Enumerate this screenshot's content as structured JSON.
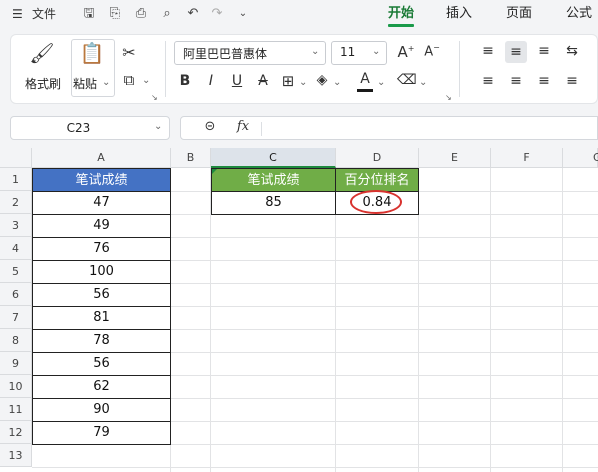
{
  "menubar": {
    "menu_icon": "☰",
    "file_label": "文件",
    "tabs": [
      "开始",
      "插入",
      "页面",
      "公式"
    ]
  },
  "ribbon": {
    "format_painter_label": "格式刷",
    "paste_label": "粘贴",
    "font_name": "阿里巴巴普惠体",
    "font_size": "11",
    "bold": "B",
    "italic": "I",
    "underline": "U",
    "strike": "A",
    "font_color_letter": "A",
    "font_color": "#1a1a1a",
    "grow_font": "A",
    "shrink_font": "A"
  },
  "formula_bar": {
    "name_box": "C23",
    "fx": "fx",
    "formula": ""
  },
  "sheet": {
    "columns": [
      "A",
      "B",
      "C",
      "D",
      "E",
      "F",
      "G"
    ],
    "rows": [
      "1",
      "2",
      "3",
      "4",
      "5",
      "6",
      "7",
      "8",
      "9",
      "10",
      "11",
      "12",
      "13"
    ],
    "a_header": "笔试成绩",
    "a_values": [
      "47",
      "49",
      "76",
      "100",
      "56",
      "81",
      "78",
      "56",
      "62",
      "90",
      "79"
    ],
    "c_header": "笔试成绩",
    "c_value": "85",
    "d_header": "百分位排名",
    "d_value": "0.84",
    "header_blue": "#4472c4",
    "header_green": "#70ad47",
    "highlight_circle": "#d8322e"
  }
}
